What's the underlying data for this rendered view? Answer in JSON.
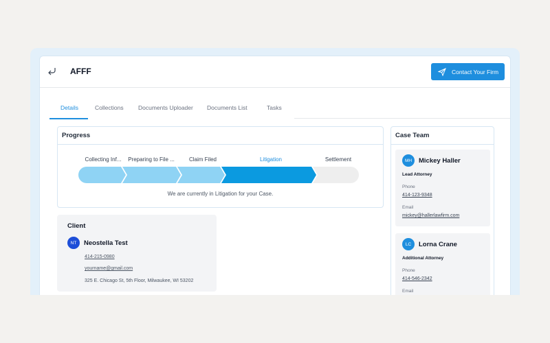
{
  "header": {
    "title": "AFFF",
    "contact_button": "Contact Your Firm"
  },
  "tabs": [
    {
      "label": "Details",
      "active": true
    },
    {
      "label": "Collections"
    },
    {
      "label": "Documents Uploader"
    },
    {
      "label": "Documents List"
    },
    {
      "label": "Tasks"
    }
  ],
  "progress": {
    "title": "Progress",
    "steps": [
      "Collecting Inf...",
      "Preparing to File ...",
      "Claim Filed",
      "Litigation",
      "Settlement"
    ],
    "current_step": "Litigation",
    "current_step_index": 3,
    "message": "We are currently in Litigation for your Case."
  },
  "client": {
    "title": "Client",
    "initials": "NT",
    "name": "Neostella Test",
    "phone": "414-215-0980",
    "email": "yourname@gmail.com",
    "address": "325 E. Chicago St, 5th Floor, Milwaukee, WI 53202"
  },
  "case_team": {
    "title": "Case Team",
    "members": [
      {
        "initials": "MH",
        "name": "Mickey Haller",
        "role": "Lead Attorney",
        "phone_label": "Phone",
        "phone": "414-123-9348",
        "email_label": "Email",
        "email": "mickey@hallerlawfirm.com"
      },
      {
        "initials": "LC",
        "name": "Lorna Crane",
        "role": "Additional Attorney",
        "phone_label": "Phone",
        "phone": "414-546-2342",
        "email_label": "Email"
      }
    ]
  },
  "colors": {
    "accent": "#1e8ede",
    "step_done": "#8fd3f4",
    "step_current": "#0b9ae0",
    "step_pending": "#eeeeee"
  }
}
